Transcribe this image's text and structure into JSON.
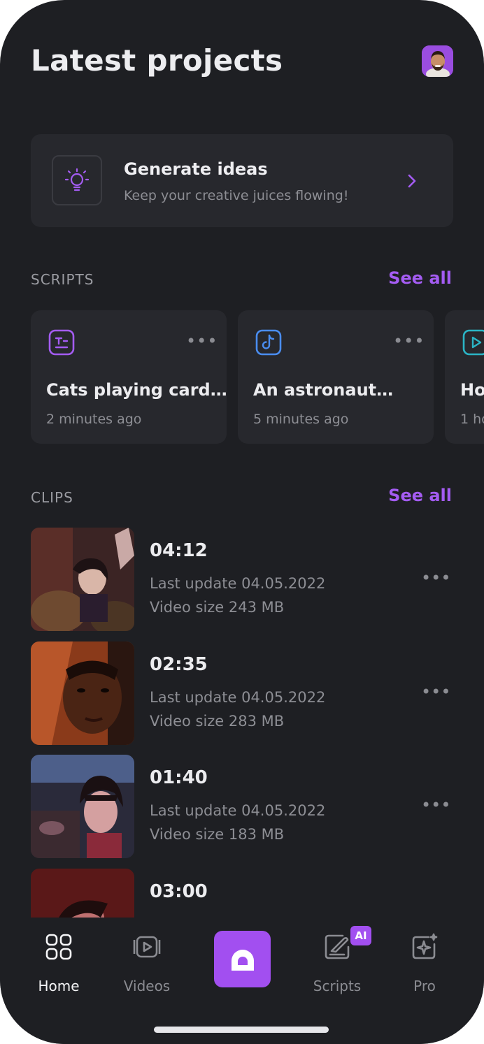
{
  "header": {
    "title": "Latest projects"
  },
  "ideas": {
    "title": "Generate ideas",
    "subtitle": "Keep your creative juices flowing!",
    "icon": "lightbulb-icon"
  },
  "scripts": {
    "label": "SCRIPTS",
    "see_all": "See all",
    "items": [
      {
        "name": "Cats playing card…",
        "time": "2 minutes ago",
        "icon": "text-doc-icon",
        "color": "#a45cf2"
      },
      {
        "name": "An astronaut…",
        "time": "5 minutes ago",
        "icon": "tiktok-icon",
        "color": "#4a8df0"
      },
      {
        "name": "Ho",
        "time": "1 ho",
        "icon": "play-icon",
        "color": "#2bb5c6"
      }
    ]
  },
  "clips": {
    "label": "CLIPS",
    "see_all": "See all",
    "items": [
      {
        "duration": "04:12",
        "updated": "Last update 04.05.2022",
        "size": "Video size 243 MB"
      },
      {
        "duration": "02:35",
        "updated": "Last update 04.05.2022",
        "size": "Video size 283 MB"
      },
      {
        "duration": "01:40",
        "updated": "Last update 04.05.2022",
        "size": "Video size 183 MB"
      },
      {
        "duration": "03:00",
        "updated": "",
        "size": ""
      }
    ]
  },
  "tabbar": {
    "home": "Home",
    "videos": "Videos",
    "scripts": "Scripts",
    "pro": "Pro",
    "ai_badge": "AI"
  },
  "colors": {
    "accent": "#a24ff0",
    "background": "#1e1f23",
    "card": "#27282d"
  }
}
